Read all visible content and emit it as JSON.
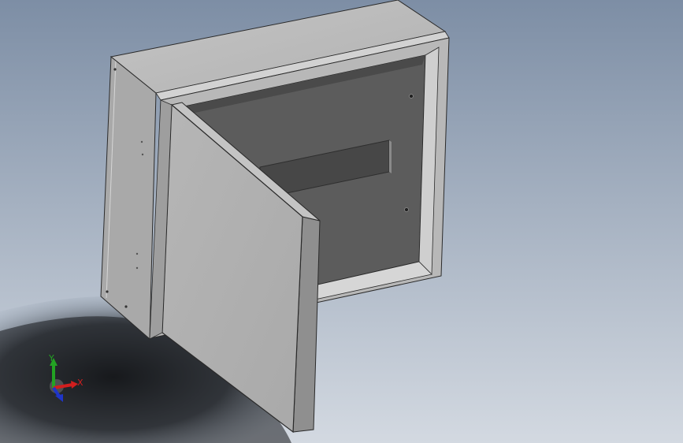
{
  "viewport": {
    "background_top": "#7f90a6",
    "background_bottom": "#cfd6df",
    "shadow_color": "#1a1d20"
  },
  "model": {
    "body_color": "#bdbdbd",
    "interior_color": "#595959",
    "frame_color": "#c8c8c8",
    "edge_color": "#2a2a2a"
  },
  "triad": {
    "x_label": "X",
    "y_label": "Y",
    "x_color": "#d21e1e",
    "y_color": "#23a323",
    "z_color": "#1f35c8"
  }
}
